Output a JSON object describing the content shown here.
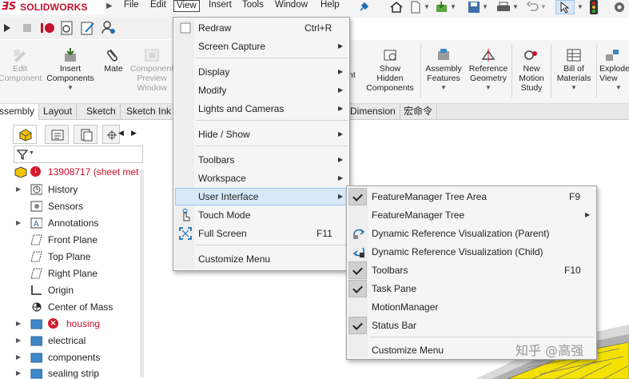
{
  "app": {
    "logo_ds": "ƎS",
    "logo_name": "SOLIDWORKS",
    "logo_arrow": "▶"
  },
  "menubar": [
    "File",
    "Edit",
    "View",
    "Insert",
    "Tools",
    "Window",
    "Help"
  ],
  "toolbar2_icons": [
    "play-icon",
    "stop-icon",
    "record-icon",
    "macro-icon",
    "edit-macro-icon",
    "user-icon"
  ],
  "commands": [
    {
      "label": "Edit\nComponent",
      "enabled": false
    },
    {
      "label": "Insert\nComponents",
      "enabled": true
    },
    {
      "label": "Mate",
      "enabled": true
    },
    {
      "label": "Component\nPreview\nWindow",
      "enabled": false
    },
    {
      "label": "Show\nHidden\nComponents",
      "enabled": true
    },
    {
      "label": "Assembly\nFeatures",
      "enabled": true
    },
    {
      "label": "Reference\nGeometry",
      "enabled": true
    },
    {
      "label": "New\nMotion\nStudy",
      "enabled": true
    },
    {
      "label": "Bill of\nMaterials",
      "enabled": true
    },
    {
      "label": "Explode\nView",
      "enabled": true
    }
  ],
  "command_partial": {
    "label": "nt"
  },
  "tabs": [
    "Assembly",
    "Layout",
    "Sketch",
    "Sketch Ink",
    "Dimension",
    "宏命令"
  ],
  "feature_tree": {
    "root": "13908717  (sheet met",
    "items": [
      "History",
      "Sensors",
      "Annotations",
      "Front Plane",
      "Top Plane",
      "Right Plane",
      "Origin",
      "Center of Mass",
      "housing",
      "electrical",
      "components",
      "sealing strip"
    ]
  },
  "view_menu": {
    "items": [
      {
        "label": "Redraw",
        "shortcut": "Ctrl+R"
      },
      {
        "label": "Screen Capture",
        "submenu": true
      },
      {
        "label": "Display",
        "submenu": true
      },
      {
        "label": "Modify",
        "submenu": true
      },
      {
        "label": "Lights and Cameras",
        "submenu": true
      },
      {
        "label": "Hide / Show",
        "submenu": true
      },
      {
        "label": "Toolbars",
        "submenu": true
      },
      {
        "label": "Workspace",
        "submenu": true
      },
      {
        "label": "User Interface",
        "submenu": true,
        "highlighted": true
      },
      {
        "label": "Touch Mode"
      },
      {
        "label": "Full Screen",
        "shortcut": "F11"
      },
      {
        "label": "Customize Menu"
      }
    ]
  },
  "ui_submenu": {
    "items": [
      {
        "label": "FeatureManager Tree Area",
        "shortcut": "F9",
        "checked": true
      },
      {
        "label": "FeatureManager Tree",
        "submenu": true
      },
      {
        "label": "Dynamic Reference Visualization (Parent)"
      },
      {
        "label": "Dynamic Reference Visualization (Child)"
      },
      {
        "label": "Toolbars",
        "shortcut": "F10",
        "checked": true
      },
      {
        "label": "Task Pane",
        "checked": true
      },
      {
        "label": "MotionManager"
      },
      {
        "label": "Status Bar",
        "checked": true
      },
      {
        "label": "Customize Menu"
      }
    ]
  },
  "watermark": "知乎 @高强",
  "colors": {
    "brand": "#c8102e",
    "highlight": "#d7e8fa",
    "error": "#d8192c",
    "folder": "#3d88c8",
    "model": "#f5e100"
  }
}
